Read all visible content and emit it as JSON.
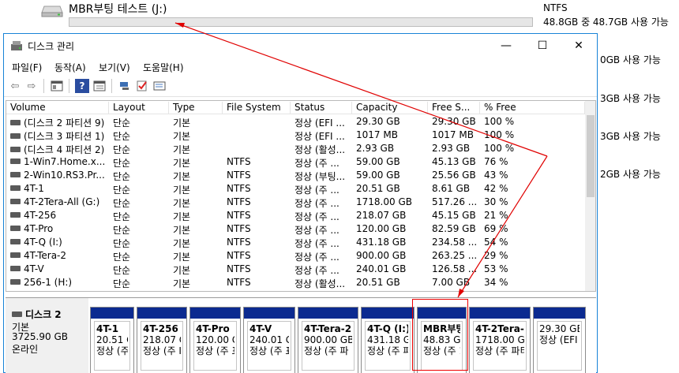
{
  "explorer": {
    "drive_title": "MBR부팅 테스트 (J:)",
    "fs": "NTFS",
    "free": "48.8GB 중 48.7GB 사용 가능",
    "side_texts": [
      "0GB 사용 가능",
      "3GB 사용 가능",
      "3GB 사용 가능",
      "2GB 사용 가능"
    ]
  },
  "window": {
    "title": "디스크 관리",
    "minimize_glyph": "—",
    "maximize_glyph": "☐",
    "close_glyph": "✕"
  },
  "menu": [
    "파일(F)",
    "동작(A)",
    "보기(V)",
    "도움말(H)"
  ],
  "toolbar": {
    "icons": [
      "back-icon",
      "forward-icon",
      "properties-icon",
      "help-icon",
      "list-view-icon",
      "connect-icon",
      "checklist-icon",
      "settings-icon"
    ],
    "back_glyph": "⇦",
    "forward_glyph": "⇨",
    "help_glyph": "?"
  },
  "volumes": {
    "headers": [
      "Volume",
      "Layout",
      "Type",
      "File System",
      "Status",
      "Capacity",
      "Free S...",
      "% Free"
    ],
    "rows": [
      [
        "(디스크 2 파티션 9)",
        "단순",
        "기본",
        "",
        "정상 (EFI ...",
        "29.30 GB",
        "29.30 GB",
        "100 %"
      ],
      [
        "(디스크 3 파티션 1)",
        "단순",
        "기본",
        "",
        "정상 (EFI ...",
        "1017 MB",
        "1017 MB",
        "100 %"
      ],
      [
        "(디스크 4 파티션 2)",
        "단순",
        "기본",
        "",
        "정상 (활성...",
        "2.93 GB",
        "2.93 GB",
        "100 %"
      ],
      [
        "1-Win7.Home.x...",
        "단순",
        "기본",
        "NTFS",
        "정상 (주 ...",
        "59.00 GB",
        "45.13 GB",
        "76 %"
      ],
      [
        "2-Win10.RS3.Pr...",
        "단순",
        "기본",
        "NTFS",
        "정상 (부팅...",
        "59.00 GB",
        "25.56 GB",
        "43 %"
      ],
      [
        "4T-1",
        "단순",
        "기본",
        "NTFS",
        "정상 (주 ...",
        "20.51 GB",
        "8.61 GB",
        "42 %"
      ],
      [
        "4T-2Tera-All (G:)",
        "단순",
        "기본",
        "NTFS",
        "정상 (주 ...",
        "1718.00 GB",
        "517.26 ...",
        "30 %"
      ],
      [
        "4T-256",
        "단순",
        "기본",
        "NTFS",
        "정상 (주 ...",
        "218.07 GB",
        "45.15 GB",
        "21 %"
      ],
      [
        "4T-Pro",
        "단순",
        "기본",
        "NTFS",
        "정상 (주 ...",
        "120.00 GB",
        "82.59 GB",
        "69 %"
      ],
      [
        "4T-Q (I:)",
        "단순",
        "기본",
        "NTFS",
        "정상 (주 ...",
        "431.18 GB",
        "234.58 ...",
        "54 %"
      ],
      [
        "4T-Tera-2",
        "단순",
        "기본",
        "NTFS",
        "정상 (주 ...",
        "900.00 GB",
        "263.25 ...",
        "29 %"
      ],
      [
        "4T-V",
        "단순",
        "기본",
        "NTFS",
        "정상 (주 ...",
        "240.01 GB",
        "126.58 ...",
        "53 %"
      ],
      [
        "256-1 (H:)",
        "단순",
        "기본",
        "NTFS",
        "정상 (활성...",
        "20.51 GB",
        "7.00 GB",
        "34 %"
      ]
    ]
  },
  "disk": {
    "name": "디스크 2",
    "type": "기본",
    "size": "3725.90 GB",
    "state": "온라인",
    "partitions": [
      {
        "name": "4T-1",
        "size": "20.51 G",
        "status": "정상 (주"
      },
      {
        "name": "4T-256",
        "size": "218.07 GE",
        "status": "정상 (주 Ⅰ"
      },
      {
        "name": "4T-Pro",
        "size": "120.00 GE",
        "status": "정상 (주 표"
      },
      {
        "name": "4T-V",
        "size": "240.01 GE",
        "status": "정상 (주 표"
      },
      {
        "name": "4T-Tera-2",
        "size": "900.00 GB",
        "status": "정상 (주 파"
      },
      {
        "name": "4T-Q (I:)",
        "size": "431.18 GB",
        "status": "정상 (주 파티"
      },
      {
        "name": "MBR부팅",
        "size": "48.83 GI",
        "status": "정상 (주 1"
      },
      {
        "name": "4T-2Tera-A",
        "size": "1718.00 GB",
        "status": "정상 (주 파티"
      },
      {
        "name": "",
        "size": "29.30 GB",
        "status": "정상 (EFI"
      }
    ]
  },
  "colors": {
    "partition_stripe": "#0b2a90",
    "annotation": "#e00000",
    "window_border": "#1883d7"
  }
}
